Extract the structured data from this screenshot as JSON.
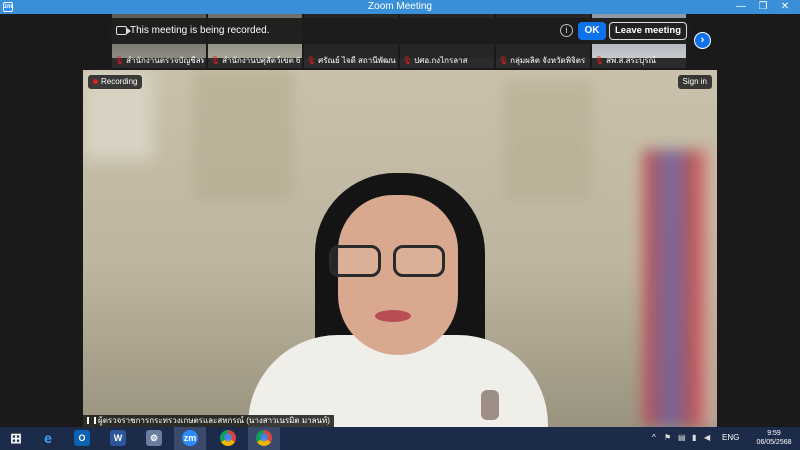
{
  "window": {
    "title": "Zoom Meeting",
    "app_icon_text": "zm",
    "controls": {
      "minimize": "—",
      "restore": "❐",
      "close": "✕"
    }
  },
  "gallery_strip": {
    "participants": [
      {
        "name": "สำนักงานตรวจบัญชีสห..."
      },
      {
        "name": "สำนักงานปศุสัตว์เขต 6"
      },
      {
        "name": "ศรัณย์ ไจดี สถานีพัฒนา..."
      },
      {
        "name": "ปศอ.กงไกรลาส"
      },
      {
        "name": "กลุ่มผลิต จังหวัดพิจิตร"
      },
      {
        "name": "สพ.ส.สระบุรณ์"
      }
    ]
  },
  "recording_banner": {
    "message": "This meeting is being recorded.",
    "info_symbol": "i",
    "ok_label": "OK",
    "leave_label": "Leave meeting"
  },
  "gallery_next_symbol": "›",
  "main_video": {
    "recording_label": "Recording",
    "signin_label": "Sign in",
    "speaker_name": "ผู้ตรวจราชการกระทรวงเกษตรและสหกรณ์ (นางสาวเนรมิต มาลนท์)"
  },
  "taskbar": {
    "apps": [
      {
        "glyph": "⊞"
      },
      {
        "glyph": "e"
      },
      {
        "glyph": "O"
      },
      {
        "glyph": "W"
      },
      {
        "glyph": "⚙"
      },
      {
        "glyph": "zm"
      },
      {
        "glyph": "◉"
      },
      {
        "glyph": "◉"
      }
    ],
    "tray": {
      "up_arrow": "^",
      "lang": "ENG",
      "time": "9:59",
      "date": "06/05/2568"
    }
  },
  "colors": {
    "accent": "#0e72ed",
    "titlebar": "#3a8fd9",
    "taskbar": "#1d2b4a",
    "mic_muted": "#e02020"
  }
}
